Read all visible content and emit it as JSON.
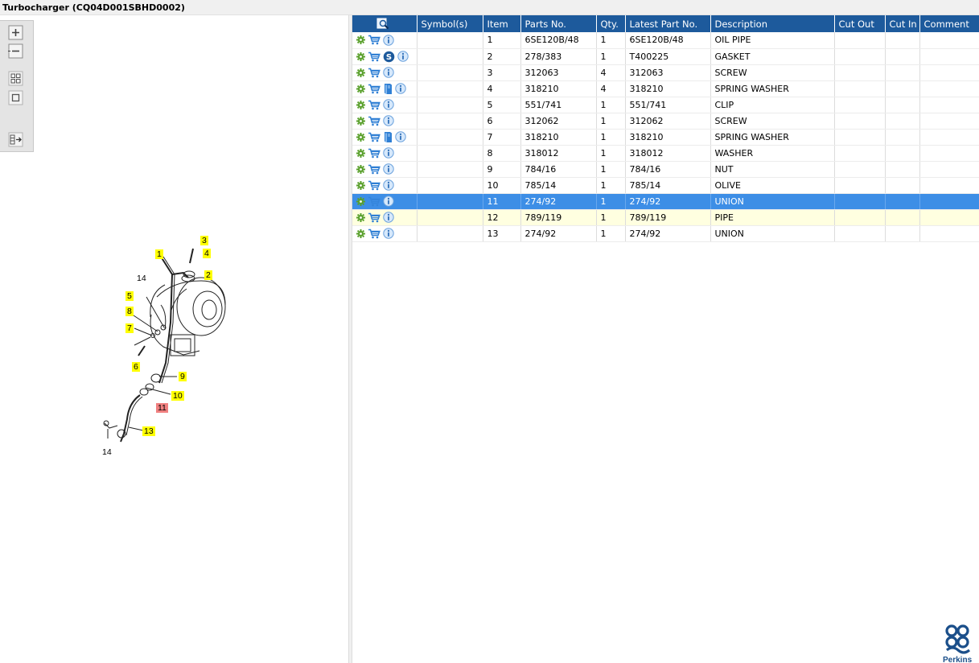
{
  "window": {
    "title": "Turbocharger (CQ04D001SBHD0002)"
  },
  "colors": {
    "header_bg": "#1d5a9c",
    "selected_row": "#3d8ee6",
    "highlight_row": "#ffffe0",
    "callout_yellow": "#ffff00",
    "callout_red": "#f08080",
    "gear_green": "#5aa02c",
    "info_blue": "#2f7fd4"
  },
  "toolbox": {
    "buttons": [
      {
        "icon": "zoom-in-icon"
      },
      {
        "icon": "zoom-out-icon"
      },
      {
        "icon": "fit-all-icon"
      },
      {
        "icon": "actual-size-icon"
      },
      {
        "icon": "toggle-list-icon"
      }
    ]
  },
  "drawing": {
    "callouts": [
      "1",
      "2",
      "3",
      "4",
      "5",
      "6",
      "7",
      "8",
      "9",
      "10",
      "11",
      "13",
      "14",
      "14"
    ],
    "selected_callout": "11"
  },
  "table": {
    "header_icon": "search-diagram-icon",
    "columns": [
      "Symbol(s)",
      "Item",
      "Parts No.",
      "Qty.",
      "Latest Part No.",
      "Description",
      "Cut Out",
      "Cut In",
      "Comment"
    ],
    "rows": [
      {
        "icons": [
          "gear-icon",
          "cart-icon",
          "info-icon"
        ],
        "item": "1",
        "part": "6SE120B/48",
        "qty": "1",
        "latest": "6SE120B/48",
        "desc": "OIL PIPE"
      },
      {
        "icons": [
          "gear-icon",
          "cart-icon",
          "supersede-icon",
          "info-icon"
        ],
        "item": "2",
        "part": "278/383",
        "qty": "1",
        "latest": "T400225",
        "desc": "GASKET"
      },
      {
        "icons": [
          "gear-icon",
          "cart-icon",
          "info-icon"
        ],
        "item": "3",
        "part": "312063",
        "qty": "4",
        "latest": "312063",
        "desc": "SCREW"
      },
      {
        "icons": [
          "gear-icon",
          "cart-icon",
          "book-icon",
          "info-icon"
        ],
        "item": "4",
        "part": "318210",
        "qty": "4",
        "latest": "318210",
        "desc": "SPRING WASHER"
      },
      {
        "icons": [
          "gear-icon",
          "cart-icon",
          "info-icon"
        ],
        "item": "5",
        "part": "551/741",
        "qty": "1",
        "latest": "551/741",
        "desc": "CLIP"
      },
      {
        "icons": [
          "gear-icon",
          "cart-icon",
          "info-icon"
        ],
        "item": "6",
        "part": "312062",
        "qty": "1",
        "latest": "312062",
        "desc": "SCREW"
      },
      {
        "icons": [
          "gear-icon",
          "cart-icon",
          "book-icon",
          "info-icon"
        ],
        "item": "7",
        "part": "318210",
        "qty": "1",
        "latest": "318210",
        "desc": "SPRING WASHER"
      },
      {
        "icons": [
          "gear-icon",
          "cart-icon",
          "info-icon"
        ],
        "item": "8",
        "part": "318012",
        "qty": "1",
        "latest": "318012",
        "desc": "WASHER"
      },
      {
        "icons": [
          "gear-icon",
          "cart-icon",
          "info-icon"
        ],
        "item": "9",
        "part": "784/16",
        "qty": "1",
        "latest": "784/16",
        "desc": "NUT"
      },
      {
        "icons": [
          "gear-icon",
          "cart-icon",
          "info-icon"
        ],
        "item": "10",
        "part": "785/14",
        "qty": "1",
        "latest": "785/14",
        "desc": "OLIVE"
      },
      {
        "icons": [
          "gear-icon",
          "cart-icon",
          "info-icon"
        ],
        "item": "11",
        "part": "274/92",
        "qty": "1",
        "latest": "274/92",
        "desc": "UNION",
        "state": "selected"
      },
      {
        "icons": [
          "gear-icon",
          "cart-icon",
          "info-icon"
        ],
        "item": "12",
        "part": "789/119",
        "qty": "1",
        "latest": "789/119",
        "desc": "PIPE",
        "state": "highlight"
      },
      {
        "icons": [
          "gear-icon",
          "cart-icon",
          "info-icon"
        ],
        "item": "13",
        "part": "274/92",
        "qty": "1",
        "latest": "274/92",
        "desc": "UNION"
      }
    ]
  },
  "logo": {
    "text": "Perkins"
  }
}
